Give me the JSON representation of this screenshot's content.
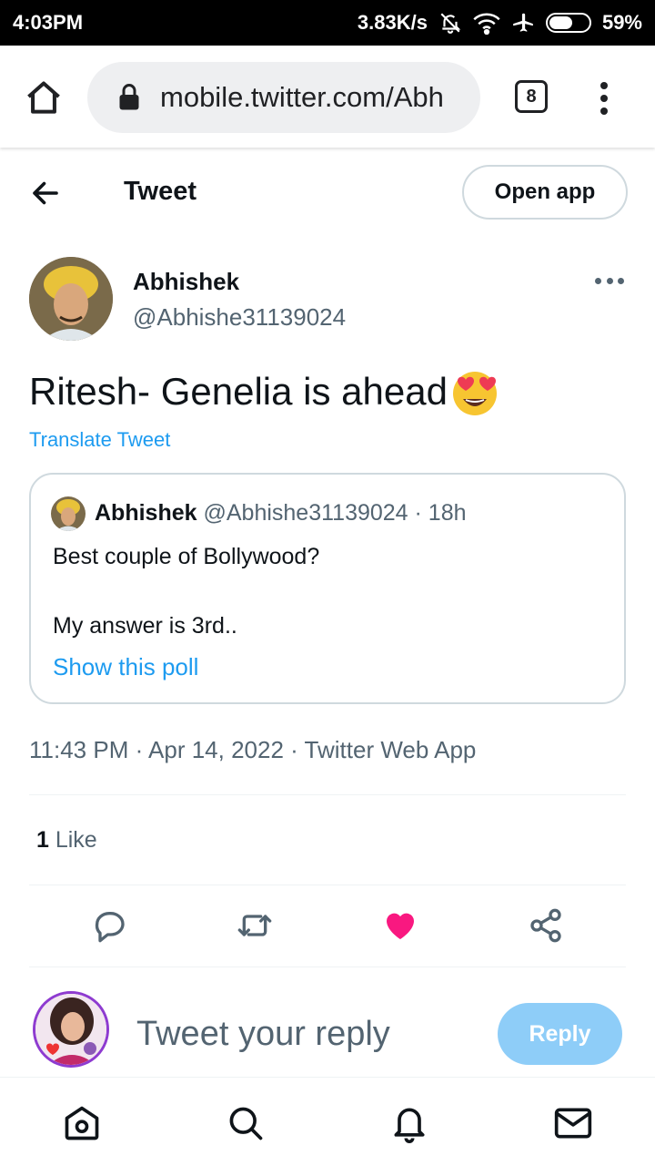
{
  "status_bar": {
    "time": "4:03PM",
    "speed": "3.83K/s",
    "battery": "59%",
    "battery_level": 0.59
  },
  "browser": {
    "url": "mobile.twitter.com/Abh",
    "tab_count": "8"
  },
  "header": {
    "title": "Tweet",
    "open_app_label": "Open app"
  },
  "tweet": {
    "author_name": "Abhishek",
    "author_handle": "@Abhishe31139024",
    "text": "Ritesh- Genelia is ahead",
    "emoji": "heart-eyes-emoji",
    "translate_label": "Translate Tweet",
    "timestamp": "11:43 PM · Apr 14, 2022 · Twitter Web App",
    "like_count": "1",
    "like_label": " Like"
  },
  "quote": {
    "author_name": "Abhishek",
    "author_handle": "@Abhishe31139024",
    "age": " · 18h",
    "line1": "Best couple of Bollywood?",
    "line2": "My answer is 3rd..",
    "show_poll_label": "Show this poll"
  },
  "reply": {
    "placeholder": "Tweet your reply",
    "button_label": "Reply"
  },
  "colors": {
    "accent": "#1d9bf0",
    "like": "#f91880",
    "reply_button": "#8ecdf8",
    "muted": "#536471"
  },
  "nav": {
    "icons": [
      "home-icon",
      "search-icon",
      "notifications-icon",
      "messages-icon"
    ]
  }
}
